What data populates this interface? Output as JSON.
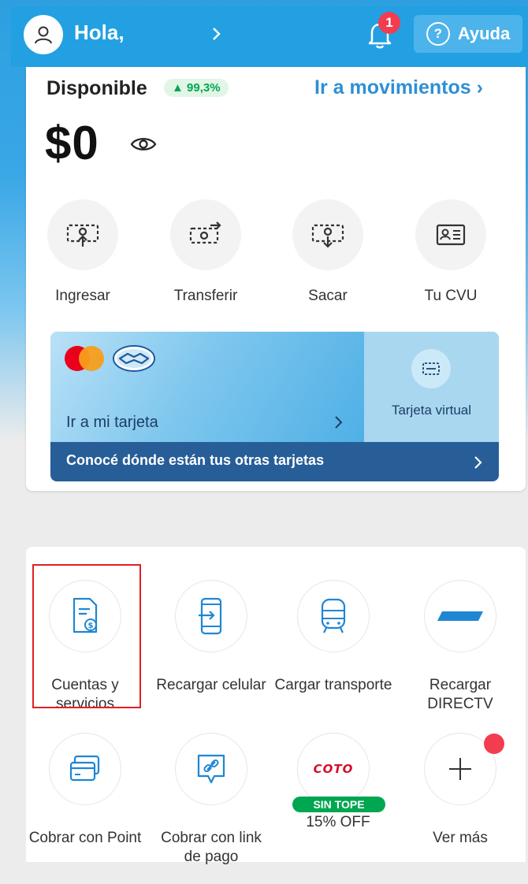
{
  "header": {
    "greeting": "Hola,",
    "notification_count": "1",
    "help_label": "Ayuda",
    "help_glyph": "?"
  },
  "account": {
    "available_label": "Disponible",
    "change_badge": "▲ 99,3%",
    "movements_link": "Ir a movimientos ›",
    "balance": "$0"
  },
  "quick_actions": [
    {
      "label": "Ingresar",
      "icon": "deposit-icon"
    },
    {
      "label": "Transferir",
      "icon": "transfer-icon"
    },
    {
      "label": "Sacar",
      "icon": "withdraw-icon"
    },
    {
      "label": "Tu CVU",
      "icon": "cvu-card-icon"
    }
  ],
  "card_banner": {
    "go_to_card": "Ir a mi tarjeta",
    "virtual_card": "Tarjeta virtual",
    "other_cards": "Conocé dónde están tus otras tarjetas"
  },
  "services": [
    {
      "label": "Cuentas y servicios",
      "icon": "bill-icon"
    },
    {
      "label": "Recargar celular",
      "icon": "phone-recharge-icon"
    },
    {
      "label": "Cargar transporte",
      "icon": "bus-icon"
    },
    {
      "label": "Recargar DIRECTV",
      "icon": "directv-icon"
    },
    {
      "label": "Cobrar con Point",
      "icon": "point-icon"
    },
    {
      "label": "Cobrar con link de pago",
      "icon": "payment-link-icon"
    },
    {
      "label": "COTO",
      "icon": "coto-logo"
    },
    {
      "label": "Ver más",
      "icon": "plus-icon"
    }
  ],
  "promo": {
    "badge": "SIN TOPE",
    "offer": "15% OFF"
  },
  "colors": {
    "brand_blue": "#22a0e2",
    "accent_link": "#2f8fd4",
    "positive_green": "#00a650",
    "badge_red": "#f23d4f",
    "card_dark_blue": "#275e97"
  }
}
